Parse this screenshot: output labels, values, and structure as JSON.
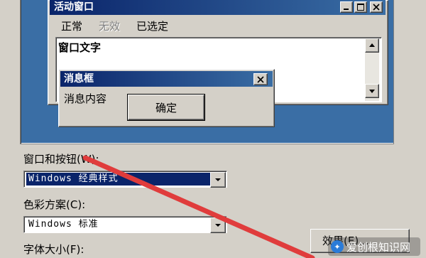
{
  "preview": {
    "active_window": {
      "title": "活动窗口",
      "menu": [
        {
          "label": "正常",
          "state": "normal"
        },
        {
          "label": "无效",
          "state": "disabled"
        },
        {
          "label": "已选定",
          "state": "normal"
        }
      ],
      "text_label": "窗口文字"
    },
    "message_box": {
      "title": "消息框",
      "content": "消息内容",
      "ok_label": "确定"
    }
  },
  "settings": {
    "windows_buttons": {
      "label": "窗口和按钮(W):",
      "value": "Windows 经典样式"
    },
    "color_scheme": {
      "label": "色彩方案(C):",
      "value": "Windows 标准"
    },
    "font_size": {
      "label": "字体大小(F):"
    },
    "effects_button": {
      "label": "效果(E)..."
    }
  },
  "watermark": {
    "text": "爱创根知识网"
  },
  "colors": {
    "desktop": "#3a6ea5",
    "titlebar_start": "#0a246a",
    "titlebar_end": "#3a6ea5",
    "face": "#d4d0c8",
    "selection": "#0a246a",
    "annotation_arrow": "#e03c3c"
  }
}
